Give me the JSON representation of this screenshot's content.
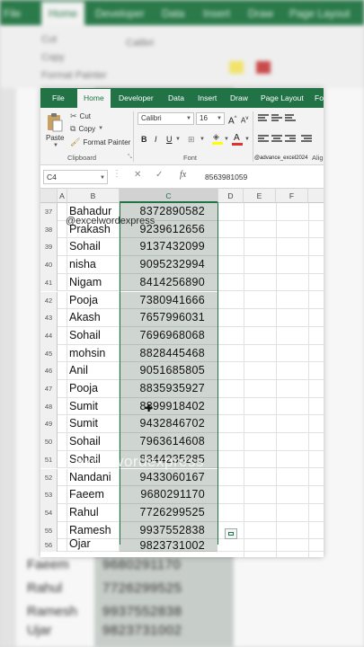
{
  "background": {
    "tabs": [
      "File",
      "Home",
      "Developer",
      "Data",
      "Insert",
      "Draw",
      "Page Layout"
    ],
    "active_tab": "Home",
    "ribbon_items": {
      "cut": "Cut",
      "copy": "Copy",
      "format_painter": "Format Painter",
      "font": "Calibri"
    },
    "rows": [
      {
        "name": "Faeem",
        "number": "9680291170"
      },
      {
        "name": "Rahul",
        "number": "7726299525"
      },
      {
        "name": "Ramesh",
        "number": "9937552838"
      },
      {
        "name": "Ujar",
        "number": "9823731002"
      }
    ]
  },
  "ribbon_tabs": [
    {
      "label": "File",
      "active": false
    },
    {
      "label": "Home",
      "active": true
    },
    {
      "label": "Developer",
      "active": false
    },
    {
      "label": "Data",
      "active": false
    },
    {
      "label": "Insert",
      "active": false
    },
    {
      "label": "Draw",
      "active": false
    },
    {
      "label": "Page Layout",
      "active": false
    },
    {
      "label": "Fo",
      "active": false
    }
  ],
  "clipboard": {
    "paste": "Paste",
    "cut": "Cut",
    "copy": "Copy",
    "format_painter": "Format Painter",
    "group_label": "Clipboard"
  },
  "font_group": {
    "font_name": "Calibri",
    "font_size": "16",
    "grow": "A",
    "shrink": "A",
    "bold": "B",
    "italic": "I",
    "underline": "U",
    "group_label": "Font",
    "fill_color": "#ffff00",
    "font_color": "#e03030"
  },
  "alignment_group": {
    "label": "Alig"
  },
  "watermark_small": "@advance_excel2024",
  "formula_bar": {
    "name_box": "C4",
    "value": "8563981059"
  },
  "columns": [
    "A",
    "B",
    "C",
    "D",
    "E",
    "F"
  ],
  "selected_column": "C",
  "rows": [
    {
      "num": "37",
      "name": "Bahadur",
      "number": "8372890582"
    },
    {
      "num": "38",
      "name": "Prakash",
      "number": "9239612656"
    },
    {
      "num": "39",
      "name": "Sohail",
      "number": "9137432099"
    },
    {
      "num": "40",
      "name": "nisha",
      "number": "9095232994"
    },
    {
      "num": "41",
      "name": "Nigam",
      "number": "8414256890"
    },
    {
      "num": "42",
      "name": "Pooja",
      "number": "7380941666"
    },
    {
      "num": "43",
      "name": "Akash",
      "number": "7657996031"
    },
    {
      "num": "44",
      "name": "Sohail",
      "number": "7696968068"
    },
    {
      "num": "45",
      "name": "mohsin",
      "number": "8828445468"
    },
    {
      "num": "46",
      "name": "Anil",
      "number": "9051685805"
    },
    {
      "num": "47",
      "name": "Pooja",
      "number": "8835935927"
    },
    {
      "num": "48",
      "name": "Sumit",
      "number": "8899918402"
    },
    {
      "num": "49",
      "name": "Sumit",
      "number": "9432846702"
    },
    {
      "num": "50",
      "name": "Sohail",
      "number": "7963614608"
    },
    {
      "num": "51",
      "name": "Sohail",
      "number": "8344235285"
    },
    {
      "num": "52",
      "name": "Nandani",
      "number": "9433060167"
    },
    {
      "num": "53",
      "name": "Faeem",
      "number": "9680291170"
    },
    {
      "num": "54",
      "name": "Rahul",
      "number": "7726299525"
    },
    {
      "num": "55",
      "name": "Ramesh",
      "number": "9937552838"
    },
    {
      "num": "56",
      "name": "Ojar",
      "number": "9823731002"
    }
  ],
  "overlays": {
    "handle_top": "@excelwordexpress",
    "handle_center": "excelwordexpress"
  },
  "colors": {
    "excel_green": "#217346",
    "selection_fill": "#cfd5d1"
  }
}
